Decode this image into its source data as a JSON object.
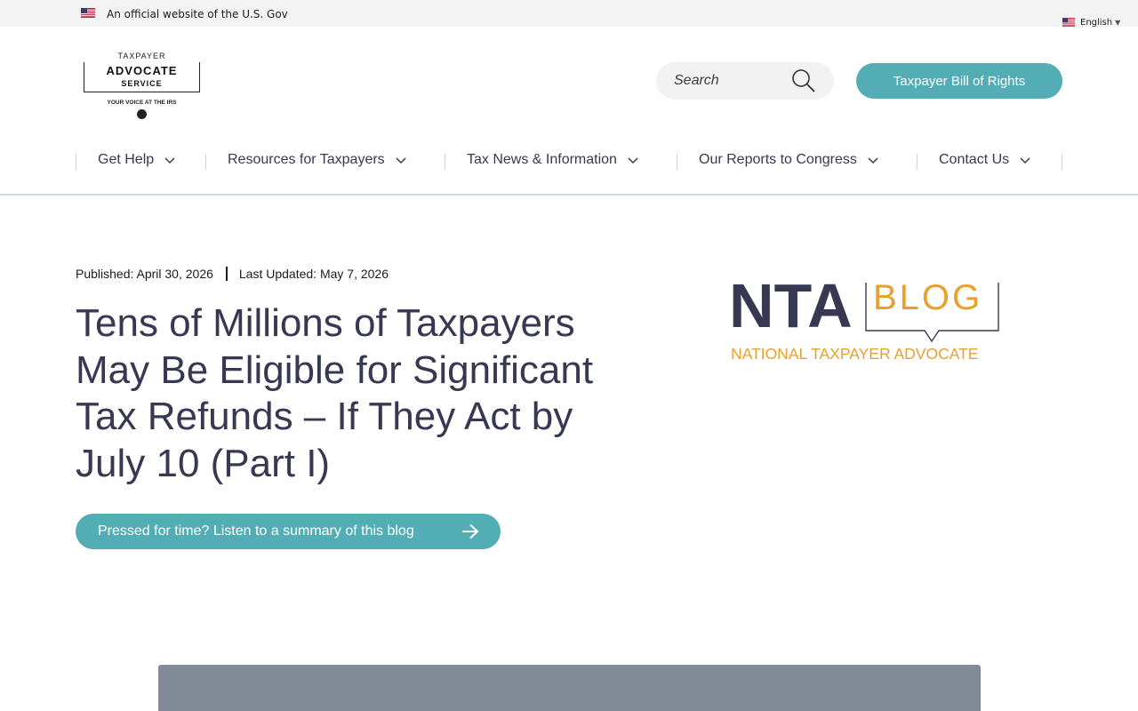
{
  "gov_banner": {
    "text": "An official website of the U.S. Gov"
  },
  "language": {
    "selected": "English"
  },
  "logo": {
    "top": "TAXPAYER",
    "line1": "ADVOCATE",
    "line2": "SERVICE",
    "tagline": "YOUR VOICE AT THE IRS"
  },
  "search": {
    "placeholder": "Search"
  },
  "header": {
    "tbor_label": "Taxpayer Bill of Rights"
  },
  "nav": {
    "items": [
      {
        "label": "Get Help"
      },
      {
        "label": "Resources for Taxpayers"
      },
      {
        "label": "Tax News & Information"
      },
      {
        "label": "Our Reports to Congress"
      },
      {
        "label": "Contact Us"
      }
    ]
  },
  "article": {
    "published": "Published: April 30, 2026",
    "updated": "Last Updated: May 7, 2026",
    "title": "Tens of Millions of Taxpayers May Be Eligible for Significant Tax Refunds – If They Act by July 10 (Part I)",
    "listen_label": "Pressed for time? Listen to a summary of this blog"
  },
  "nta_logo": {
    "main": "NTA",
    "blog": "BLOG",
    "sub": "NATIONAL TAXPAYER ADVOCATE"
  },
  "colors": {
    "teal": "#52aeb4",
    "navy": "#373852",
    "orange": "#e8a02e",
    "media_gray": "#838a97"
  }
}
